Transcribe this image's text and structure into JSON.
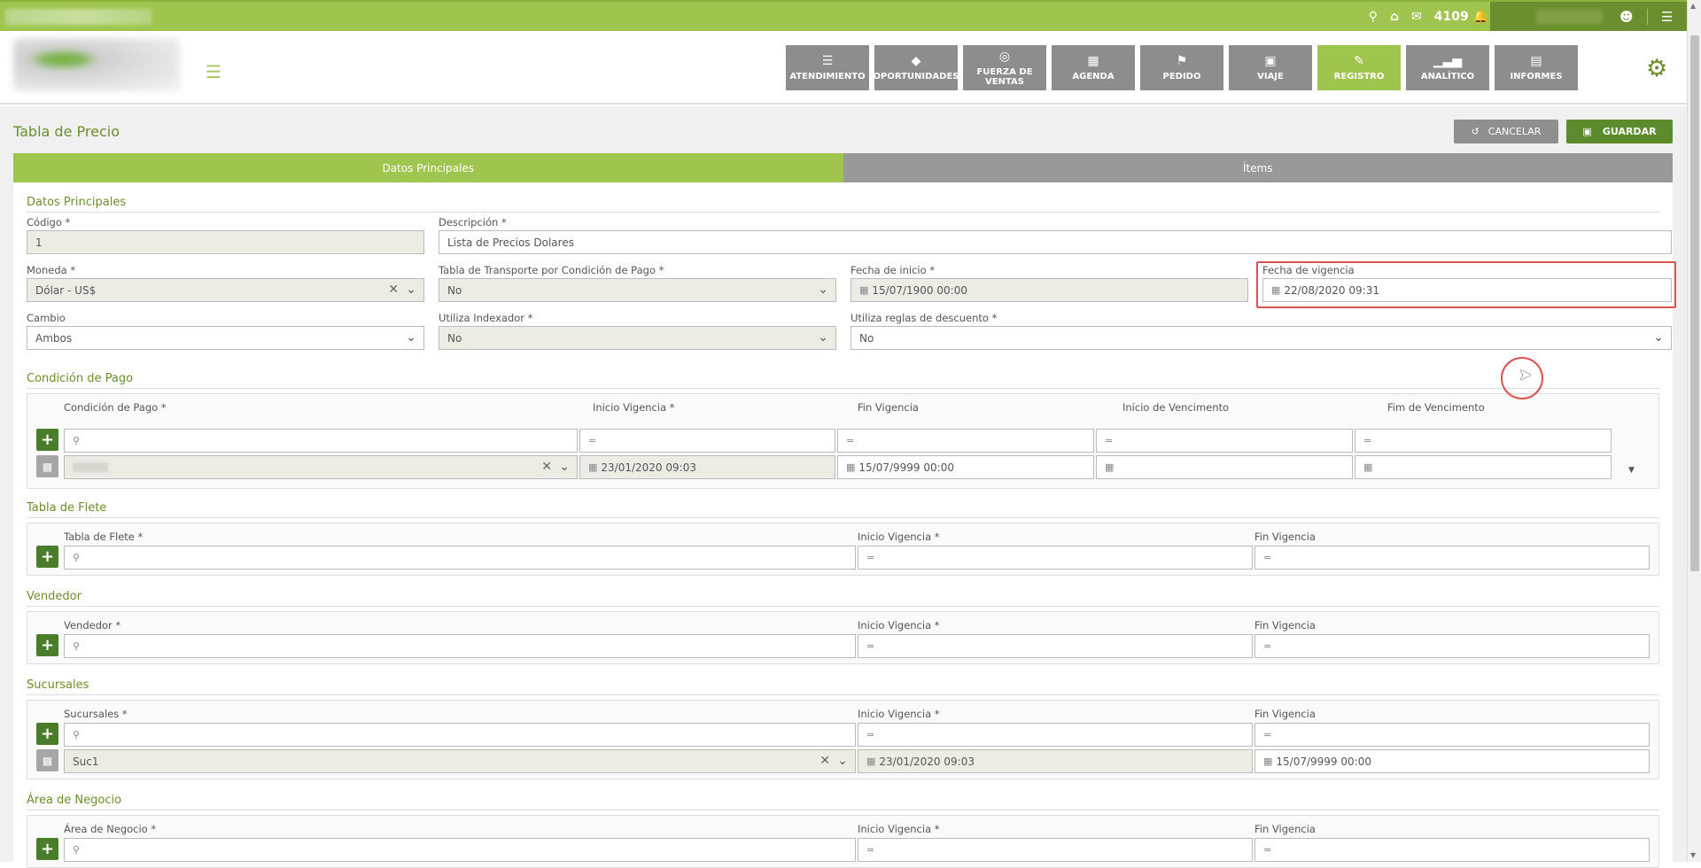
{
  "topbar": {
    "count": "4109"
  },
  "nav": [
    {
      "label": "ATENDIMIENTO",
      "icon": "list-check-icon"
    },
    {
      "label": "OPORTUNIDADES",
      "icon": "diamond-icon"
    },
    {
      "label": "FUERZA DE VENTAS",
      "icon": "target-icon"
    },
    {
      "label": "AGENDA",
      "icon": "calendar-icon"
    },
    {
      "label": "PEDIDO",
      "icon": "tag-icon"
    },
    {
      "label": "VIAJE",
      "icon": "briefcase-icon"
    },
    {
      "label": "REGISTRO",
      "icon": "edit-icon"
    },
    {
      "label": "ANALÍTICO",
      "icon": "bar-chart-icon"
    },
    {
      "label": "INFORMES",
      "icon": "list-alt-icon"
    }
  ],
  "page": {
    "title": "Tabla de Precio",
    "cancel": "CANCELAR",
    "save": "GUARDAR",
    "tabs": [
      "Datos Principales",
      "Ítems"
    ]
  },
  "datos": {
    "section": "Datos Principales",
    "codigo_label": "Código *",
    "codigo": "1",
    "descripcion_label": "Descripción *",
    "descripcion": "Lista de Precios Dolares",
    "moneda_label": "Moneda *",
    "moneda": "Dólar - US$",
    "transporte_label": "Tabla de Transporte por Condición de Pago *",
    "transporte": "No",
    "fecha_inicio_label": "Fecha de inicio *",
    "fecha_inicio": "15/07/1900 00:00",
    "fecha_vigencia_label": "Fecha de vigencia",
    "fecha_vigencia": "22/08/2020 09:31",
    "cambio_label": "Cambio",
    "cambio": "Ambos",
    "indexador_label": "Utiliza Indexador *",
    "indexador": "No",
    "reglas_label": "Utiliza reglas de descuento *",
    "reglas": "No"
  },
  "condicion": {
    "section": "Condición de Pago",
    "headers": [
      "Condición de Pago *",
      "Inicio Vigencia *",
      "Fin Vigencia",
      "Início de Vencimento",
      "Fim de Vencimento"
    ],
    "row": {
      "inicio": "23/01/2020 09:03",
      "fin": "15/07/9999 00:00"
    }
  },
  "flete": {
    "section": "Tabla de Flete",
    "headers": [
      "Tabla de Flete *",
      "Inicio Vigencia *",
      "Fin Vigencia"
    ]
  },
  "vendedor": {
    "section": "Vendedor",
    "headers": [
      "Vendedor *",
      "Inicio Vigencia *",
      "Fin Vigencia"
    ]
  },
  "sucursales": {
    "section": "Sucursales",
    "headers": [
      "Sucursales *",
      "Inicio Vigencia *",
      "Fin Vigencia"
    ],
    "row": {
      "name": "Suc1",
      "inicio": "23/01/2020 09:03",
      "fin": "15/07/9999 00:00"
    }
  },
  "area": {
    "section": "Área de Negocio",
    "headers": [
      "Área de Negocio *",
      "Inicio Vigencia *",
      "Fin Vigencia"
    ]
  }
}
